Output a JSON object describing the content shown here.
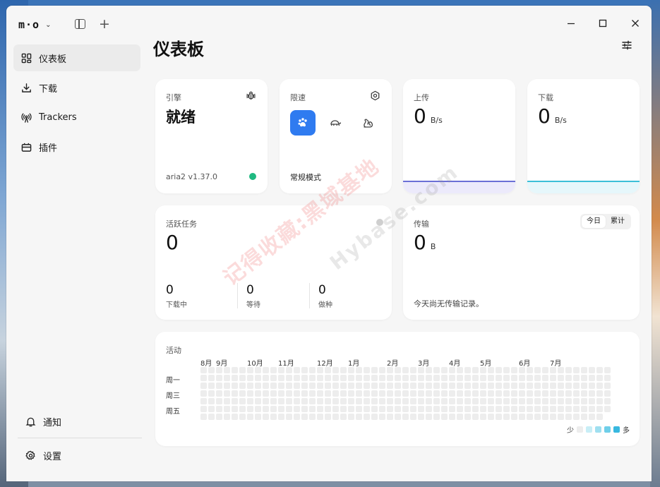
{
  "app": {
    "logo": "m·o",
    "page_title": "仪表板"
  },
  "sidebar": {
    "items": [
      {
        "label": "仪表板",
        "icon": "dashboard-icon",
        "active": true
      },
      {
        "label": "下载",
        "icon": "download-icon"
      },
      {
        "label": "Trackers",
        "icon": "antenna-icon"
      },
      {
        "label": "插件",
        "icon": "plugin-icon"
      }
    ],
    "bottom": [
      {
        "label": "通知",
        "icon": "bell-icon"
      },
      {
        "label": "设置",
        "icon": "gear-icon"
      }
    ]
  },
  "engine": {
    "label": "引擎",
    "status": "就绪",
    "version": "aria2 v1.37.0",
    "status_color": "#1fb981"
  },
  "speed_limit": {
    "label": "限速",
    "mode": "常规模式",
    "accent": "#2f7bf0"
  },
  "upload": {
    "label": "上传",
    "value": "0",
    "unit": "B/s",
    "color": "#6b6fd6"
  },
  "download": {
    "label": "下载",
    "value": "0",
    "unit": "B/s",
    "color": "#3cbfd8"
  },
  "active_tasks": {
    "label": "活跃任务",
    "value": "0",
    "stats": [
      {
        "value": "0",
        "label": "下载中"
      },
      {
        "value": "0",
        "label": "等待"
      },
      {
        "value": "0",
        "label": "做种"
      }
    ]
  },
  "transfer": {
    "label": "传输",
    "value": "0",
    "unit": "B",
    "tabs": [
      "今日",
      "累计"
    ],
    "empty_text": "今天尚无传输记录。"
  },
  "activity": {
    "label": "活动",
    "months": [
      "8月",
      "9月",
      "10月",
      "11月",
      "12月",
      "1月",
      "2月",
      "3月",
      "4月",
      "5月",
      "6月",
      "7月"
    ],
    "days": [
      "周一",
      "周三",
      "周五"
    ],
    "legend_less": "少",
    "legend_more": "多",
    "legend_colors": [
      "#ededed",
      "#c8eef6",
      "#9fdff0",
      "#6fcfe9",
      "#38b8df"
    ]
  },
  "watermark": {
    "cn": "记得收藏:黑域基地",
    "en": "Hybase.com"
  }
}
